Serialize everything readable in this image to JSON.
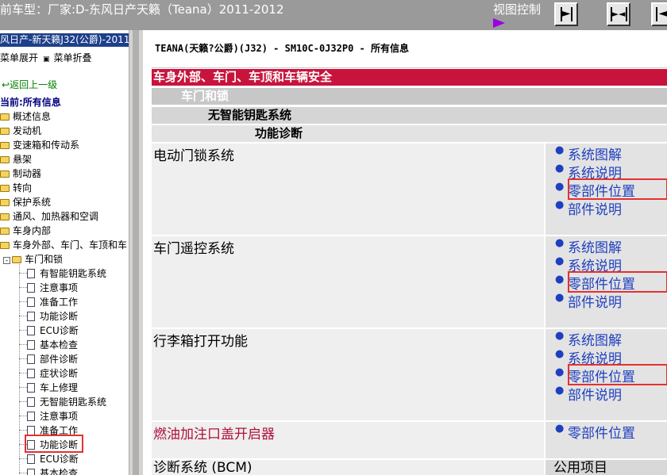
{
  "topbar": {
    "car_model": "前车型：厂家:D-东风日产天籁（Teana）2011-2012",
    "view_control_label": "视图控制",
    "buttons": [
      {
        "name": "expand-right-button",
        "glyph": "►"
      },
      {
        "name": "center-split-button",
        "glyph": "►◄"
      },
      {
        "name": "expand-left-button",
        "glyph": "◄"
      }
    ]
  },
  "sidebar": {
    "header": "风日产-新天籁J32(公爵)-2011",
    "expand_menu": "菜单展开",
    "collapse_menu": "菜单折叠",
    "back_link": "返回上一级",
    "current": "当前:所有信息",
    "folders": [
      "概述信息",
      "发动机",
      "变速箱和传动系",
      "悬架",
      "制动器",
      "转向",
      "保护系统",
      "通风、加热器和空调",
      "车身内部",
      "车身外部、车门、车顶和车"
    ],
    "subfolder": "车门和锁",
    "docs": [
      "有智能钥匙系统",
      "注意事项",
      "准备工作",
      "功能诊断",
      "ECU诊断",
      "基本检查",
      "部件诊断",
      "症状诊断",
      "车上修理",
      "无智能钥匙系统",
      "注意事项",
      "准备工作",
      "功能诊断",
      "ECU诊断",
      "基本检查"
    ],
    "selected_doc_index": 13
  },
  "content": {
    "doc_title": "TEANA(天籁?公爵)(J32) - SM10C-0J32P0 - 所有信息",
    "section": "车身外部、车门、车顶和车辆安全",
    "subsection": "车门和锁",
    "subsubsection": "无智能钥匙系统",
    "subsubsubsection": "功能诊断",
    "rows": [
      {
        "title": "电动门锁系统",
        "links": [
          "系统图解",
          "系统说明",
          "零部件位置",
          "部件说明"
        ],
        "highlighted": 2
      },
      {
        "title": "车门遥控系统",
        "links": [
          "系统图解",
          "系统说明",
          "零部件位置",
          "部件说明"
        ],
        "highlighted": 2
      },
      {
        "title": "行李箱打开功能",
        "links": [
          "系统图解",
          "系统说明",
          "零部件位置",
          "部件说明"
        ],
        "highlighted": 2
      },
      {
        "title": "燃油加注口盖开启器",
        "links": [
          "零部件位置"
        ],
        "highlighted": -1
      }
    ],
    "bottom_left": "诊断系统 (BCM)",
    "bottom_right": "公用项目"
  },
  "colors": {
    "section_red": "#c8143c",
    "link_blue": "#1f3fbf",
    "highlight_red": "#e53030",
    "sidebar_header": "#1e3f8a"
  }
}
